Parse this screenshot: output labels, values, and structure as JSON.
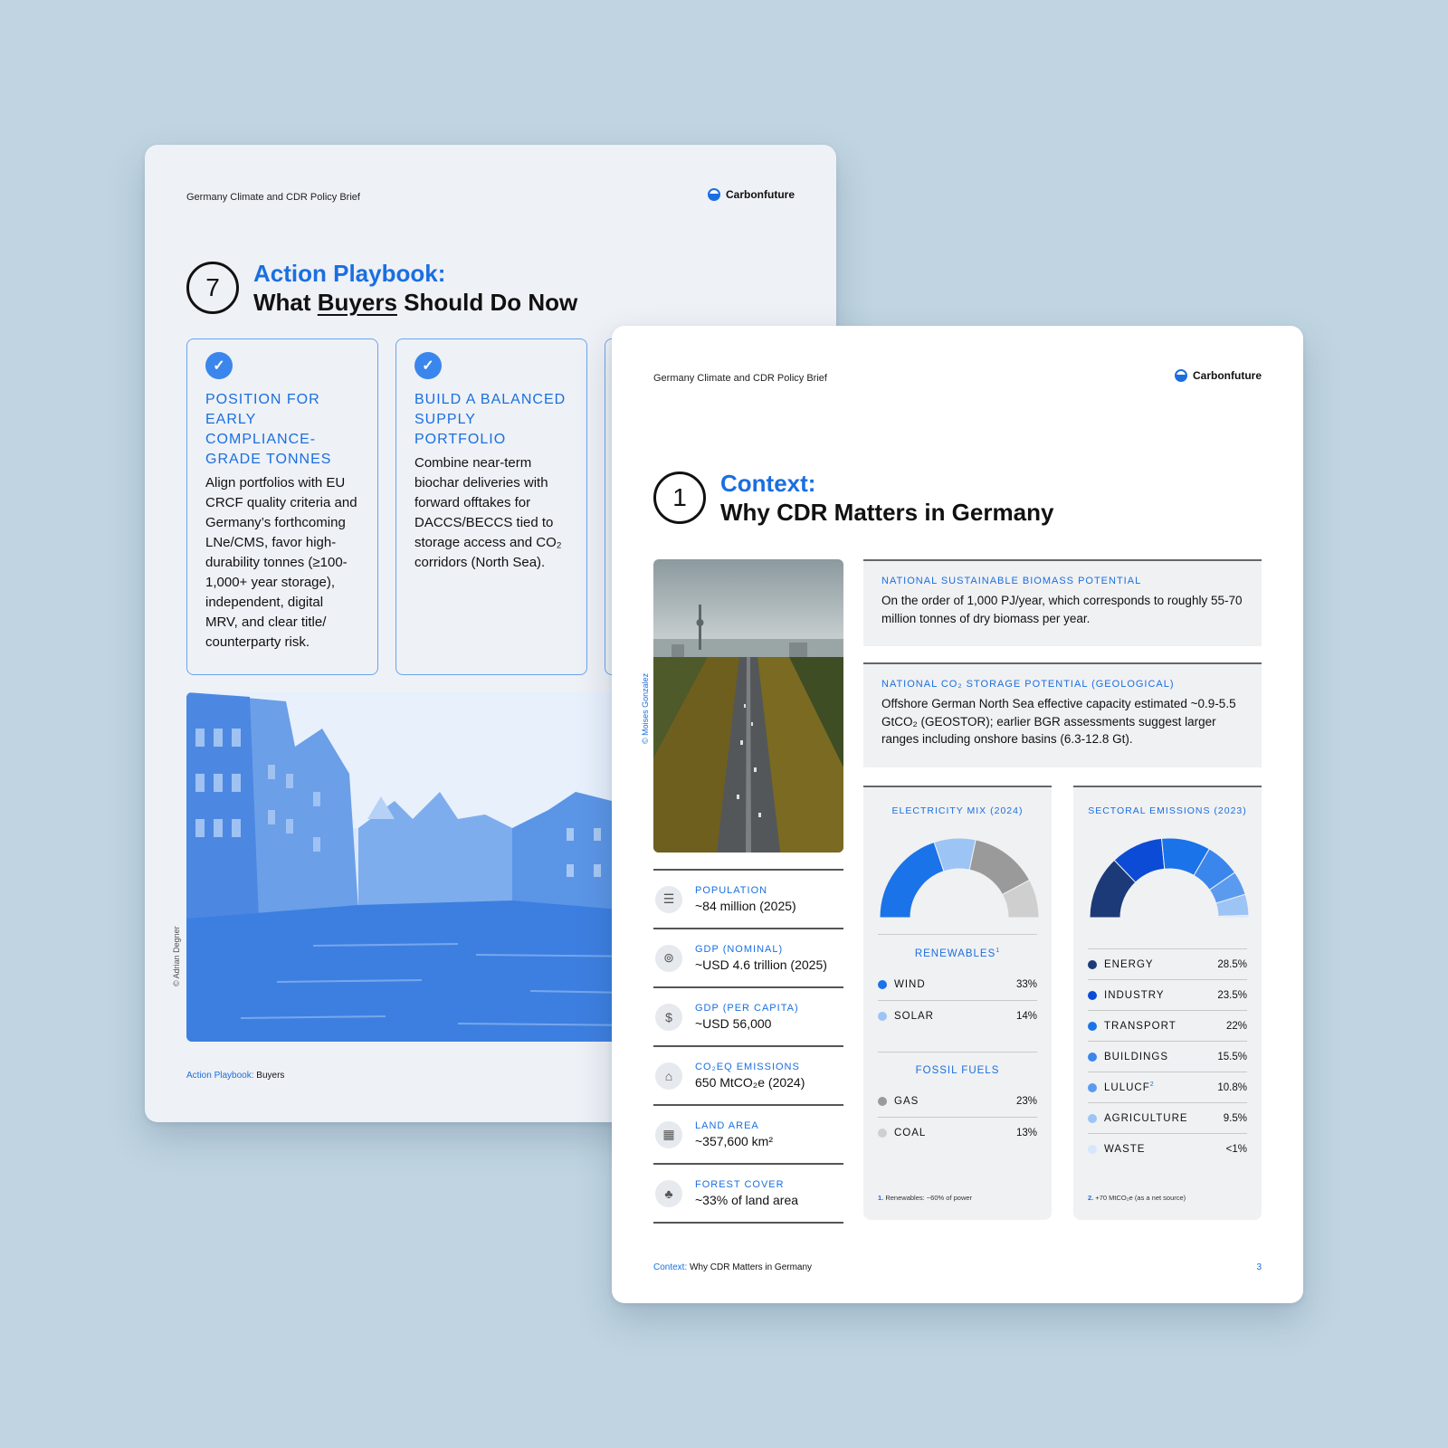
{
  "back_page": {
    "doc_title": "Germany Climate and CDR Policy Brief",
    "brand": "Carbonfuture",
    "section_number": "7",
    "section_title": "Action Playbook:",
    "section_subtitle_pre": "What ",
    "section_subtitle_underlined": "Buyers",
    "section_subtitle_post": " Should Do Now",
    "cards": [
      {
        "heading": "Position for early compliance-grade tonnes",
        "body": "Align portfolios with EU CRCF quality criteria and Germany’s forthcoming LNe/CMS, favor high-durability tonnes (≥100-1,000+ year storage), independent, digital MRV, and clear title/ counterparty risk."
      },
      {
        "heading": "Build a balanced supply portfolio",
        "body": "Combine near-term biochar deliveries with forward offtakes for DACCS/BECCS tied to storage access and CO₂ corridors (North Sea)."
      }
    ],
    "photo_credit": "© Adrian Degner",
    "footer_section": "Action Playbook:",
    "footer_topic": " Buyers"
  },
  "front_page": {
    "doc_title": "Germany Climate and CDR Policy Brief",
    "brand": "Carbonfuture",
    "section_number": "1",
    "section_title": "Context:",
    "section_subtitle": "Why CDR Matters in Germany",
    "photo_credit": "© Moises Gonzalez",
    "stats": [
      {
        "label": "Population",
        "value": "~84 million (2025)",
        "icon": "population-icon"
      },
      {
        "label": "GDP (Nominal)",
        "value": "~USD 4.6 trillion (2025)",
        "icon": "gdp-nominal-icon"
      },
      {
        "label": "GDP (per capita)",
        "value": "~USD 56,000",
        "icon": "gdp-per-capita-icon"
      },
      {
        "label": "CO₂eq Emissions",
        "value": "650 MtCO₂e (2024)",
        "icon": "emissions-icon"
      },
      {
        "label": "Land Area",
        "value": "~357,600 km²",
        "icon": "land-area-icon"
      },
      {
        "label": "Forest Cover",
        "value": "~33% of land area",
        "icon": "forest-icon"
      }
    ],
    "biomass": {
      "label": "National Sustainable Biomass Potential",
      "text": "On the order of 1,000 PJ/year, which corresponds to roughly 55-70 million tonnes of dry biomass per year."
    },
    "storage": {
      "label": "National CO₂ Storage Potential (Geological)",
      "text": "Offshore German North Sea effective capacity estimated ~0.9-5.5 GtCO₂ (GEOSTOR); earlier BGR assessments suggest larger ranges including onshore basins (6.3-12.8 Gt)."
    },
    "electricity": {
      "title": "Electricity Mix (2024)",
      "renewables_head": "RENEWABLES",
      "renewables_sup": "1",
      "fossil_head": "FOSSIL FUELS",
      "note_num": "1.",
      "note_text": " Renewables: ~60% of power"
    },
    "sectoral": {
      "title": "Sectoral Emissions (2023)",
      "note_num": "2.",
      "note_text": " +70 MtCO₂e (as a net source)"
    },
    "footer_section": "Context:",
    "footer_topic": " Why CDR Matters in Germany",
    "page_number": "3"
  },
  "chart_data": [
    {
      "type": "pie",
      "title": "Electricity Mix (2024)",
      "categories": [
        "WIND",
        "SOLAR",
        "GAS",
        "COAL"
      ],
      "values": [
        33,
        14,
        23,
        13
      ],
      "value_labels": [
        "33%",
        "14%",
        "23%",
        "13%"
      ],
      "groups": {
        "RENEWABLES": [
          "WIND",
          "SOLAR"
        ],
        "FOSSIL FUELS": [
          "GAS",
          "COAL"
        ]
      },
      "colors": [
        "#1a73e8",
        "#9cc4f5",
        "#9a9a9a",
        "#cfcfcf"
      ]
    },
    {
      "type": "pie",
      "title": "Sectoral Emissions (2023)",
      "categories": [
        "ENERGY",
        "INDUSTRY",
        "TRANSPORT",
        "BUILDINGS",
        "LULUCF",
        "AGRICULTURE",
        "WASTE"
      ],
      "values": [
        28.5,
        23.5,
        22,
        15.5,
        10.8,
        9.5,
        1
      ],
      "value_labels": [
        "28.5%",
        "23.5%",
        "22%",
        "15.5%",
        "10.8%",
        "9.5%",
        "<1%"
      ],
      "sup": {
        "LULUCF": "2"
      },
      "colors": [
        "#1d3a78",
        "#0c4bd6",
        "#1a73e8",
        "#3a86ec",
        "#5a9bf0",
        "#9cc4f5",
        "#d6e6fb"
      ]
    }
  ]
}
